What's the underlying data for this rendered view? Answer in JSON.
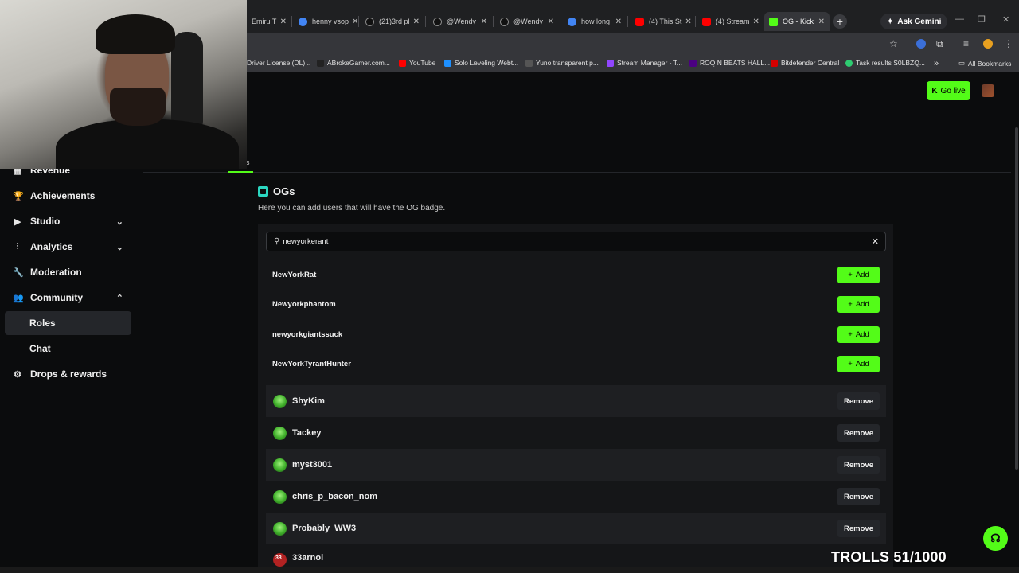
{
  "browser": {
    "tabs": [
      {
        "label": "Emiru T",
        "color": "#ffffff"
      },
      {
        "label": "henny vsop",
        "color": "#4285f4"
      },
      {
        "label": "(21)3rd pl",
        "color": "#000000"
      },
      {
        "label": "@Wendy",
        "color": "#000000"
      },
      {
        "label": "@Wendy",
        "color": "#000000"
      },
      {
        "label": "how long",
        "color": "#4285f4"
      },
      {
        "label": "(4) This St",
        "color": "#ff0000"
      },
      {
        "label": "(4) Stream",
        "color": "#ff0000"
      },
      {
        "label": "OG - Kick",
        "color": "#53fc18",
        "active": true
      }
    ],
    "ask_gemini": "Ask Gemini",
    "bookmarks": [
      {
        "label": "Driver License (DL)...",
        "color": "#e0e0e0"
      },
      {
        "label": "ABrokeGamer.com...",
        "color": "#222222"
      },
      {
        "label": "YouTube",
        "color": "#ff0000"
      },
      {
        "label": "Solo Leveling Webt...",
        "color": "#1e90ff"
      },
      {
        "label": "Yuno transparent p...",
        "color": "#555555"
      },
      {
        "label": "Stream Manager - T...",
        "color": "#9146ff"
      },
      {
        "label": "ROQ N BEATS HALL...",
        "color": "#4b0082"
      },
      {
        "label": "Bitdefender Central",
        "color": "#d40000"
      },
      {
        "label": "Task results S0LBZQ...",
        "color": "#2ecc71"
      }
    ],
    "bookmarks_overflow": "»",
    "all_bookmarks": "All Bookmarks"
  },
  "header": {
    "go_live": "Go live"
  },
  "subnav": {
    "visible_char": "s"
  },
  "sidebar": {
    "items": [
      {
        "label": "Revenue",
        "icon": "revenue-icon",
        "glyph": "▦"
      },
      {
        "label": "Achievements",
        "icon": "trophy-icon",
        "glyph": "🏆"
      },
      {
        "label": "Studio",
        "icon": "studio-icon",
        "glyph": "▶",
        "chevron": "⌄"
      },
      {
        "label": "Analytics",
        "icon": "analytics-icon",
        "glyph": "⫶",
        "chevron": "⌄"
      },
      {
        "label": "Moderation",
        "icon": "wrench-icon",
        "glyph": "🔧"
      },
      {
        "label": "Community",
        "icon": "community-icon",
        "glyph": "👥",
        "chevron": "⌃"
      },
      {
        "label": "Roles",
        "sub": true,
        "active": true
      },
      {
        "label": "Chat",
        "sub": true
      },
      {
        "label": "Drops & rewards",
        "icon": "drops-icon",
        "glyph": "⚙"
      }
    ]
  },
  "og": {
    "title": "OGs",
    "description": "Here you can add users that will have the OG badge.",
    "search_value": "newyorkerant",
    "add_label": "Add",
    "remove_label": "Remove",
    "results": [
      "NewYorkRat",
      "Newyorkphantom",
      "newyorkgiantssuck",
      "NewYorkTyrantHunter"
    ],
    "members": [
      "ShyKim",
      "Tackey",
      "myst3001",
      "chris_p_bacon_nom",
      "Probably_WW3",
      "33arnol"
    ]
  },
  "overlay": {
    "trolls": "TROLLS 51/1000"
  },
  "colors": {
    "accent": "#53fc18",
    "background": "#0b0c0d",
    "panel": "#151618"
  }
}
